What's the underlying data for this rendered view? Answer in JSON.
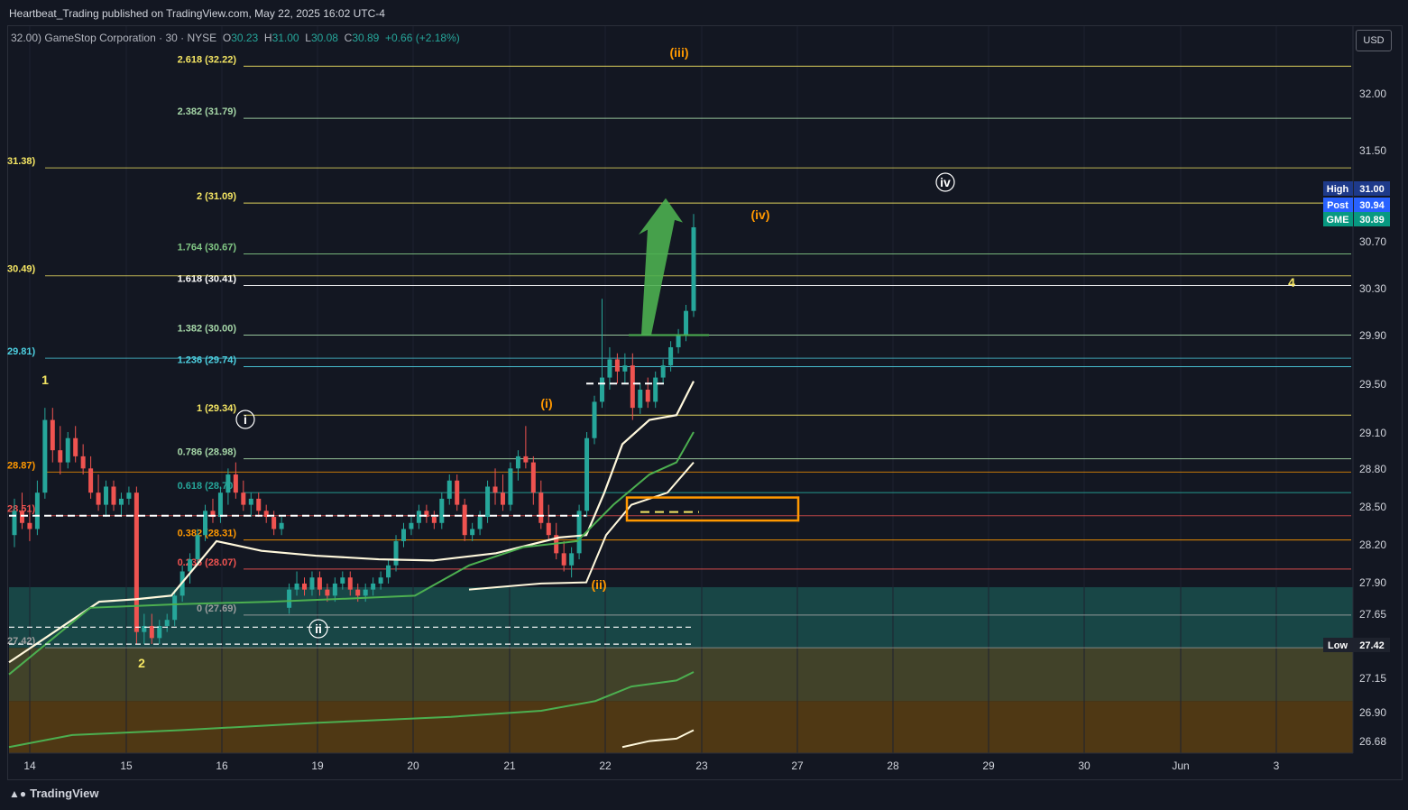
{
  "publisher_line": "Heartbeat_Trading published on TradingView.com, May 22, 2025 16:02 UTC-4",
  "symbol": {
    "partial_prefix": "32.00)",
    "name": "GameStop Corporation",
    "interval": "30",
    "exchange": "NYSE",
    "o_label": "O",
    "o": "30.23",
    "h_label": "H",
    "h": "31.00",
    "l_label": "L",
    "l": "30.08",
    "c_label": "C",
    "c": "30.89",
    "change": "+0.66 (+2.18%)"
  },
  "currency_button": "USD",
  "brand": "TradingView",
  "colors": {
    "up": "#26a69a",
    "down": "#ef5350",
    "fib_yellow": "#f5e663",
    "fib_green": "#4caf50",
    "fib_teal": "#4dd0e1",
    "fib_orange": "#ff9800",
    "fib_red": "#ef5350",
    "arrow": "#4caf50",
    "zone_teal": "#1a4f4c",
    "zone_olive": "#4a4a2a",
    "zone_brown": "#5a3e12"
  },
  "chart_data": {
    "type": "candlestick",
    "ylim": [
      26.55,
      32.55
    ],
    "y_ticks": [
      "32.00",
      "31.50",
      "30.70",
      "30.30",
      "29.90",
      "29.50",
      "29.10",
      "28.80",
      "28.50",
      "28.20",
      "27.90",
      "27.65",
      "27.15",
      "26.90",
      "26.68"
    ],
    "x_ticks": [
      "14",
      "15",
      "16",
      "19",
      "20",
      "21",
      "22",
      "23",
      "27",
      "28",
      "29",
      "30",
      "Jun",
      "3"
    ],
    "price_badges": [
      {
        "label": "High",
        "value": "31.00",
        "color": "#1e3a8a"
      },
      {
        "label": "Post",
        "value": "30.94",
        "color": "#2962ff"
      },
      {
        "label": "GME",
        "value": "30.89",
        "color": "#089981"
      },
      {
        "label": "Low",
        "value": "27.42",
        "color": "#1e222d"
      }
    ],
    "fib_levels": [
      {
        "label": "2.618 (32.22)",
        "price": 32.22,
        "color": "#f5e663"
      },
      {
        "label": "2.382 (31.79)",
        "price": 31.79,
        "color": "#a5d6a7"
      },
      {
        "label": "2 (31.09)",
        "price": 31.09,
        "color": "#f5e663"
      },
      {
        "label": "1.764 (30.67)",
        "price": 30.67,
        "color": "#81c784"
      },
      {
        "label": "1.618 (30.41)",
        "price": 30.41,
        "color": "#ffffff"
      },
      {
        "label": "1.382 (30.00)",
        "price": 30.0,
        "color": "#a5d6a7"
      },
      {
        "label": "1.236 (29.74)",
        "price": 29.74,
        "color": "#4dd0e1"
      },
      {
        "label": "1 (29.34)",
        "price": 29.34,
        "color": "#f5e663"
      },
      {
        "label": "0.786 (28.98)",
        "price": 28.98,
        "color": "#a5d6a7"
      },
      {
        "label": "0.618 (28.70)",
        "price": 28.7,
        "color": "#26a69a"
      },
      {
        "label": "0.382 (28.31)",
        "price": 28.31,
        "color": "#ff9800"
      },
      {
        "label": "0.236 (28.07)",
        "price": 28.07,
        "color": "#ef5350"
      },
      {
        "label": "0 (27.69)",
        "price": 27.69,
        "color": "#9e9e9e"
      }
    ],
    "left_partial_labels": [
      {
        "text": "31.38)",
        "price": 31.38,
        "color": "#f5e663"
      },
      {
        "text": "30.49)",
        "price": 30.49,
        "color": "#f5e663"
      },
      {
        "text": "29.81)",
        "price": 29.81,
        "color": "#4dd0e1"
      },
      {
        "text": "28.87)",
        "price": 28.87,
        "color": "#ff9800"
      },
      {
        "text": "28.51)",
        "price": 28.51,
        "color": "#ef5350"
      },
      {
        "text": "27.42)",
        "price": 27.42,
        "color": "#9e9e9e"
      }
    ],
    "wave_labels": [
      {
        "text": "(iii)",
        "color": "#ff9800",
        "circled": false
      },
      {
        "text": "iv",
        "color": "#ffffff",
        "circled": true
      },
      {
        "text": "(iv)",
        "color": "#ff9800",
        "circled": false
      },
      {
        "text": "4",
        "color": "#f5e663",
        "circled": false
      },
      {
        "text": "1",
        "color": "#f5e663",
        "circled": false
      },
      {
        "text": "i",
        "color": "#ffffff",
        "circled": true
      },
      {
        "text": "(i)",
        "color": "#ff9800",
        "circled": false
      },
      {
        "text": "(ii)",
        "color": "#ff9800",
        "circled": false
      },
      {
        "text": "ii",
        "color": "#ffffff",
        "circled": true
      },
      {
        "text": "2",
        "color": "#f5e663",
        "circled": false
      }
    ],
    "zones": [
      {
        "from": 27.42,
        "to": 27.92,
        "color": "#1a4f4c"
      },
      {
        "from": 26.98,
        "to": 27.42,
        "color": "#4a4a2a"
      },
      {
        "from": 26.55,
        "to": 26.98,
        "color": "#5a3e12"
      }
    ],
    "candles": [
      [
        28.35,
        28.65,
        28.25,
        28.55
      ],
      [
        28.55,
        28.7,
        28.4,
        28.45
      ],
      [
        28.45,
        28.6,
        28.3,
        28.4
      ],
      [
        28.4,
        28.8,
        28.35,
        28.7
      ],
      [
        28.7,
        29.4,
        28.65,
        29.3
      ],
      [
        29.3,
        29.4,
        28.95,
        29.05
      ],
      [
        29.05,
        29.25,
        28.85,
        28.95
      ],
      [
        28.95,
        29.2,
        28.9,
        29.15
      ],
      [
        29.15,
        29.25,
        28.95,
        29.0
      ],
      [
        29.0,
        29.1,
        28.85,
        28.9
      ],
      [
        28.9,
        29.0,
        28.65,
        28.7
      ],
      [
        28.7,
        28.85,
        28.55,
        28.6
      ],
      [
        28.6,
        28.8,
        28.5,
        28.75
      ],
      [
        28.75,
        28.8,
        28.55,
        28.6
      ],
      [
        28.6,
        28.7,
        28.5,
        28.65
      ],
      [
        28.65,
        28.75,
        28.6,
        28.7
      ],
      [
        28.7,
        28.75,
        27.45,
        27.55
      ],
      [
        27.55,
        27.7,
        27.45,
        27.6
      ],
      [
        27.6,
        27.7,
        27.45,
        27.5
      ],
      [
        27.5,
        27.65,
        27.45,
        27.6
      ],
      [
        27.6,
        27.7,
        27.55,
        27.65
      ],
      [
        27.65,
        27.9,
        27.6,
        27.85
      ],
      [
        27.85,
        28.1,
        27.8,
        28.05
      ],
      [
        28.05,
        28.2,
        27.95,
        28.15
      ],
      [
        28.15,
        28.4,
        28.1,
        28.35
      ],
      [
        28.35,
        28.6,
        28.3,
        28.55
      ],
      [
        28.55,
        28.65,
        28.45,
        28.5
      ],
      [
        28.5,
        28.75,
        28.45,
        28.7
      ],
      [
        28.7,
        28.9,
        28.6,
        28.85
      ],
      [
        28.85,
        28.95,
        28.65,
        28.7
      ],
      [
        28.7,
        28.8,
        28.55,
        28.6
      ],
      [
        28.6,
        28.7,
        28.5,
        28.65
      ],
      [
        28.65,
        28.7,
        28.5,
        28.55
      ],
      [
        28.55,
        28.6,
        28.45,
        28.5
      ],
      [
        28.5,
        28.55,
        28.35,
        28.4
      ],
      [
        28.4,
        28.5,
        28.35,
        28.45
      ],
      [
        27.75,
        27.95,
        27.7,
        27.9
      ],
      [
        27.9,
        28.05,
        27.85,
        27.95
      ],
      [
        27.95,
        28.0,
        27.85,
        27.9
      ],
      [
        27.9,
        28.05,
        27.85,
        28.0
      ],
      [
        28.0,
        28.05,
        27.85,
        27.9
      ],
      [
        27.9,
        27.95,
        27.8,
        27.85
      ],
      [
        27.85,
        28.0,
        27.8,
        27.95
      ],
      [
        27.95,
        28.05,
        27.9,
        28.0
      ],
      [
        28.0,
        28.05,
        27.85,
        27.9
      ],
      [
        27.9,
        27.95,
        27.8,
        27.85
      ],
      [
        27.85,
        27.95,
        27.8,
        27.9
      ],
      [
        27.9,
        28.0,
        27.85,
        27.95
      ],
      [
        27.95,
        28.05,
        27.9,
        28.0
      ],
      [
        28.0,
        28.15,
        27.95,
        28.1
      ],
      [
        28.1,
        28.35,
        28.05,
        28.3
      ],
      [
        28.3,
        28.45,
        28.25,
        28.4
      ],
      [
        28.4,
        28.5,
        28.35,
        28.45
      ],
      [
        28.45,
        28.6,
        28.4,
        28.55
      ],
      [
        28.55,
        28.6,
        28.45,
        28.5
      ],
      [
        28.5,
        28.55,
        28.4,
        28.45
      ],
      [
        28.45,
        28.7,
        28.4,
        28.65
      ],
      [
        28.65,
        28.85,
        28.6,
        28.8
      ],
      [
        28.8,
        28.85,
        28.55,
        28.6
      ],
      [
        28.6,
        28.65,
        28.3,
        28.35
      ],
      [
        28.35,
        28.45,
        28.3,
        28.4
      ],
      [
        28.4,
        28.55,
        28.35,
        28.5
      ],
      [
        28.5,
        28.8,
        28.45,
        28.75
      ],
      [
        28.75,
        28.9,
        28.6,
        28.7
      ],
      [
        28.7,
        28.85,
        28.55,
        28.6
      ],
      [
        28.6,
        28.95,
        28.55,
        28.9
      ],
      [
        28.9,
        29.05,
        28.8,
        29.0
      ],
      [
        29.0,
        29.25,
        28.9,
        28.95
      ],
      [
        28.95,
        29.0,
        28.6,
        28.7
      ],
      [
        28.7,
        28.8,
        28.4,
        28.45
      ],
      [
        28.45,
        28.6,
        28.3,
        28.35
      ],
      [
        28.35,
        28.45,
        28.15,
        28.2
      ],
      [
        28.2,
        28.3,
        28.05,
        28.1
      ],
      [
        28.1,
        28.25,
        28.0,
        28.2
      ],
      [
        28.2,
        28.6,
        28.15,
        28.55
      ],
      [
        28.55,
        29.2,
        28.5,
        29.15
      ],
      [
        29.15,
        29.5,
        29.1,
        29.45
      ],
      [
        29.45,
        30.3,
        29.4,
        29.65
      ],
      [
        29.65,
        29.9,
        29.55,
        29.8
      ],
      [
        29.8,
        29.85,
        29.6,
        29.7
      ],
      [
        29.7,
        29.85,
        29.6,
        29.75
      ],
      [
        29.75,
        29.85,
        29.3,
        29.4
      ],
      [
        29.4,
        29.6,
        29.35,
        29.55
      ],
      [
        29.55,
        29.65,
        29.4,
        29.45
      ],
      [
        29.45,
        29.7,
        29.4,
        29.65
      ],
      [
        29.65,
        29.8,
        29.6,
        29.75
      ],
      [
        29.75,
        29.95,
        29.7,
        29.9
      ],
      [
        29.9,
        30.05,
        29.85,
        30.0
      ],
      [
        30.0,
        30.25,
        29.95,
        30.2
      ],
      [
        30.2,
        31.0,
        30.15,
        30.89
      ]
    ]
  }
}
